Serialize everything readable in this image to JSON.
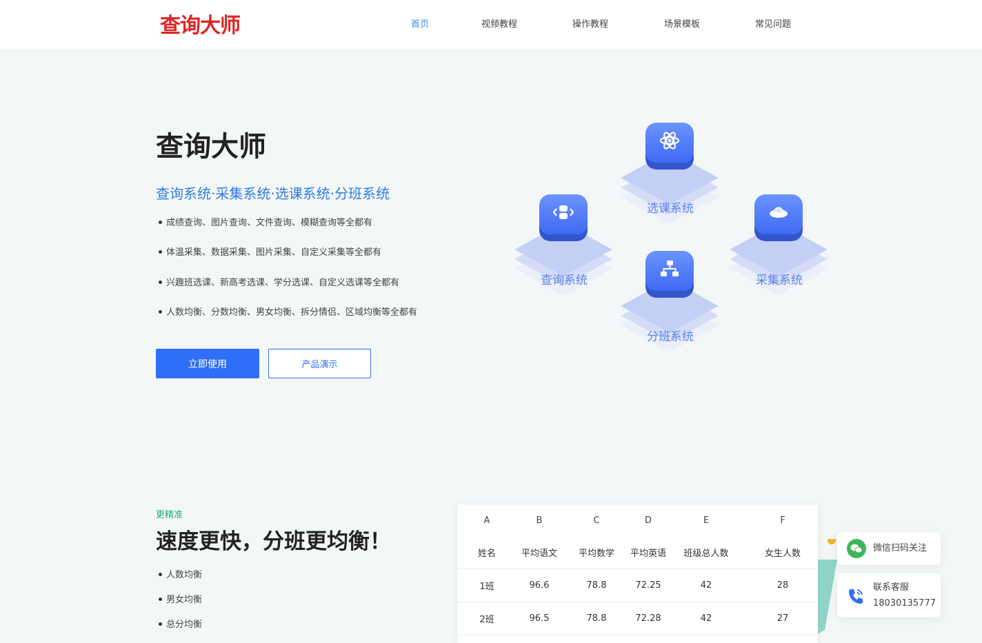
{
  "header": {
    "logo": "查询大师",
    "nav": [
      {
        "label": "首页",
        "active": true
      },
      {
        "label": "视频教程",
        "active": false
      },
      {
        "label": "操作教程",
        "active": false
      },
      {
        "label": "场景模板",
        "active": false
      },
      {
        "label": "常见问题",
        "active": false
      }
    ]
  },
  "hero": {
    "title": "查询大师",
    "subtitle": "查询系统·采集系统·选课系统·分班系统",
    "features": [
      "成绩查询、图片查询、文件查询、模糊查询等全都有",
      "体温采集、数据采集、图片采集、自定义采集等全都有",
      "兴趣班选课、新高考选课、学分选课、自定义选课等全都有",
      "人数均衡、分数均衡、男女均衡、拆分情侣、区域均衡等全都有"
    ],
    "primary_button": "立即使用",
    "secondary_button": "产品演示"
  },
  "systems": [
    {
      "label": "选课系统",
      "icon": "atom-icon"
    },
    {
      "label": "查询系统",
      "icon": "code-query-icon"
    },
    {
      "label": "采集系统",
      "icon": "collect-icon"
    },
    {
      "label": "分班系统",
      "icon": "hierarchy-icon"
    }
  ],
  "section2": {
    "kicker": "更精准",
    "title": "速度更快，分班更均衡！",
    "features": [
      "人数均衡",
      "男女均衡",
      "总分均衡"
    ]
  },
  "sheet": {
    "columns": [
      "A",
      "B",
      "C",
      "D",
      "E",
      "F"
    ],
    "headers": [
      "姓名",
      "平均语文",
      "平均数学",
      "平均英语",
      "班级总人数",
      "女生人数"
    ],
    "rows": [
      [
        "1班",
        "96.6",
        "78.8",
        "72.25",
        "42",
        "28"
      ],
      [
        "2班",
        "96.5",
        "78.8",
        "72.28",
        "42",
        "27"
      ]
    ]
  },
  "side": {
    "wechat_label": "微信扫码关注",
    "service_label": "联系客服",
    "service_phone": "18030135777"
  },
  "colors": {
    "accent": "#2f6ff7",
    "logo": "#e02424",
    "kicker": "#19b37a",
    "tile_label": "#5b82e8"
  }
}
